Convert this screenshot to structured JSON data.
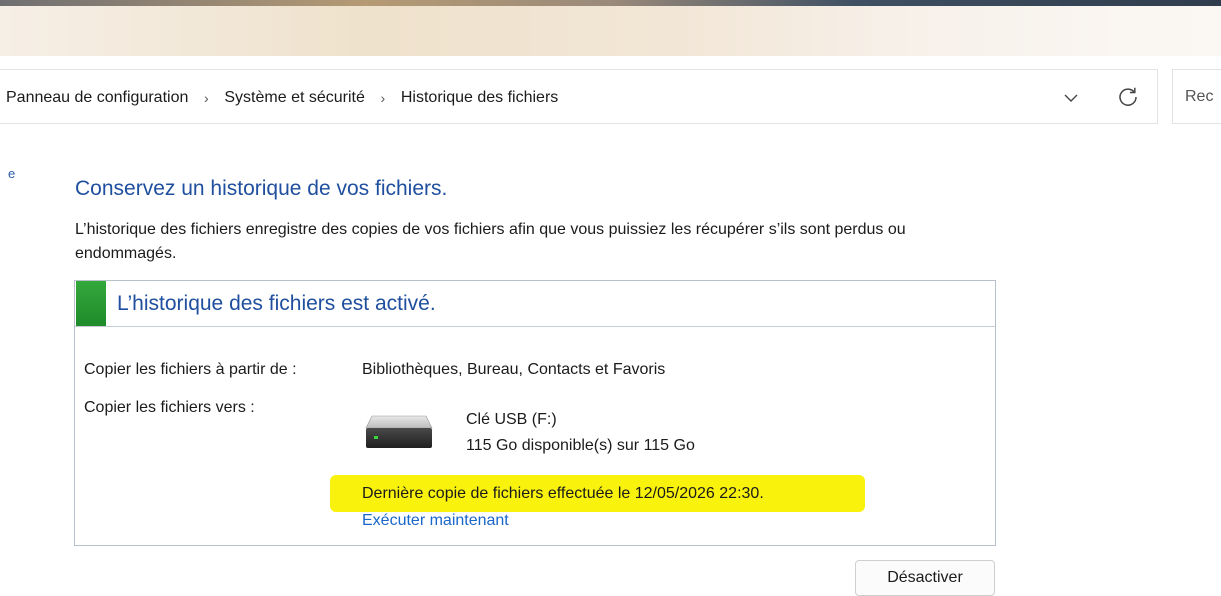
{
  "breadcrumb": {
    "items": [
      "Panneau de configuration",
      "Système et sécurité",
      "Historique des fichiers"
    ],
    "separator": "›"
  },
  "search": {
    "placeholder_partial": "Rec"
  },
  "left_pane": {
    "fragment": "e"
  },
  "main": {
    "heading": "Conservez un historique de vos fichiers.",
    "description": "L’historique des fichiers enregistre des copies de vos fichiers afin que vous puissiez les récupérer s’ils sont perdus ou endommagés."
  },
  "panel": {
    "status": "L’historique des fichiers est activé.",
    "status_color": "#2a9a35",
    "copy_from_label": "Copier les fichiers à partir de :",
    "copy_from_value": "Bibliothèques, Bureau, Contacts et Favoris",
    "copy_to_label": "Copier les fichiers vers :",
    "drive_name": "Clé USB (F:)",
    "drive_space": "115 Go disponible(s) sur 115 Go",
    "last_copy": "Dernière copie de fichiers effectuée le 12/05/2026 22:30.",
    "run_now": "Exécuter maintenant",
    "highlight_color": "#f9f20c"
  },
  "buttons": {
    "deactivate": "Désactiver"
  },
  "icons": {
    "dropdown": "chevron-down-icon",
    "refresh": "refresh-icon",
    "drive": "usb-drive-icon"
  }
}
